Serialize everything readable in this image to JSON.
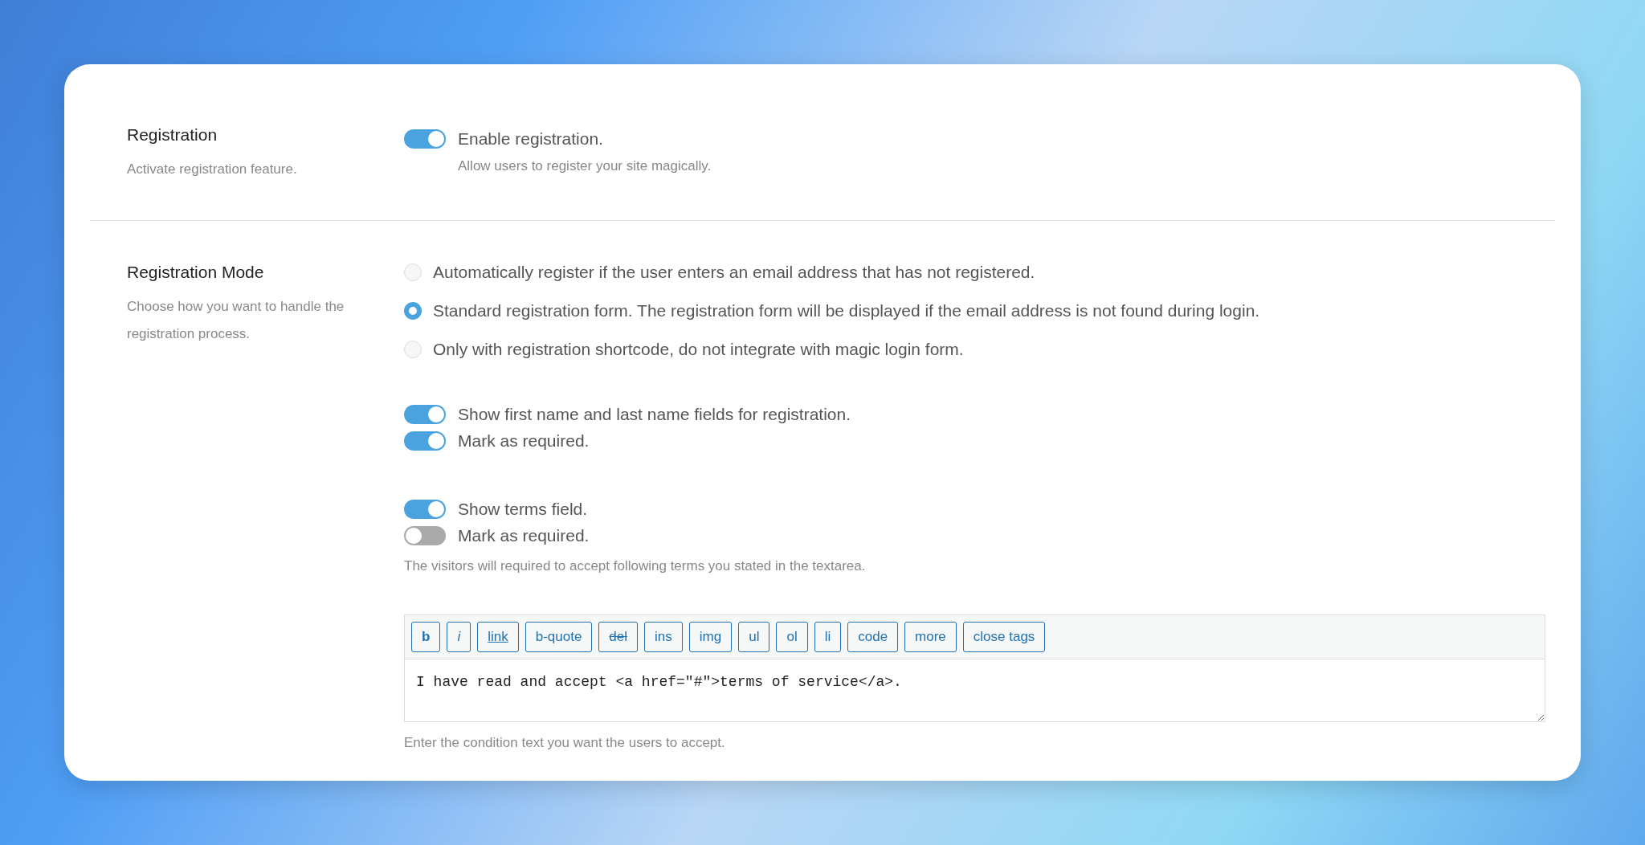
{
  "sections": [
    {
      "title": "Registration",
      "description": "Activate registration feature.",
      "toggle_groups": [
        {
          "toggles": [
            {
              "label": "Enable registration.",
              "on": true
            }
          ],
          "note": "Allow users to register your site magically."
        }
      ]
    },
    {
      "title": "Registration Mode",
      "description": "Choose how you want to handle the registration process.",
      "radios": [
        {
          "label": "Automatically register if the user enters an email address that has not registered.",
          "selected": false
        },
        {
          "label": "Standard registration form. The registration form will be displayed if the email address is not found during login.",
          "selected": true
        },
        {
          "label": "Only with registration shortcode, do not integrate with magic login form.",
          "selected": false
        }
      ],
      "toggle_groups": [
        {
          "toggles": [
            {
              "label": "Show first name and last name fields for registration.",
              "on": true
            },
            {
              "label": "Mark as required.",
              "on": true
            }
          ]
        },
        {
          "toggles": [
            {
              "label": "Show terms field.",
              "on": true
            },
            {
              "label": "Mark as required.",
              "on": false
            }
          ],
          "note": "The visitors will required to accept following terms you stated in the textarea."
        }
      ],
      "editor": {
        "buttons": [
          {
            "label": "b",
            "kind": "bold"
          },
          {
            "label": "i",
            "kind": "italic"
          },
          {
            "label": "link",
            "kind": "underline"
          },
          {
            "label": "b-quote",
            "kind": "plain"
          },
          {
            "label": "del",
            "kind": "strike"
          },
          {
            "label": "ins",
            "kind": "plain"
          },
          {
            "label": "img",
            "kind": "plain"
          },
          {
            "label": "ul",
            "kind": "plain"
          },
          {
            "label": "ol",
            "kind": "plain"
          },
          {
            "label": "li",
            "kind": "plain"
          },
          {
            "label": "code",
            "kind": "plain"
          },
          {
            "label": "more",
            "kind": "plain"
          },
          {
            "label": "close tags",
            "kind": "plain"
          }
        ],
        "value": "I have read and accept <a href=\"#\">terms of service</a>.",
        "help": "Enter the condition text you want the users to accept."
      }
    }
  ]
}
